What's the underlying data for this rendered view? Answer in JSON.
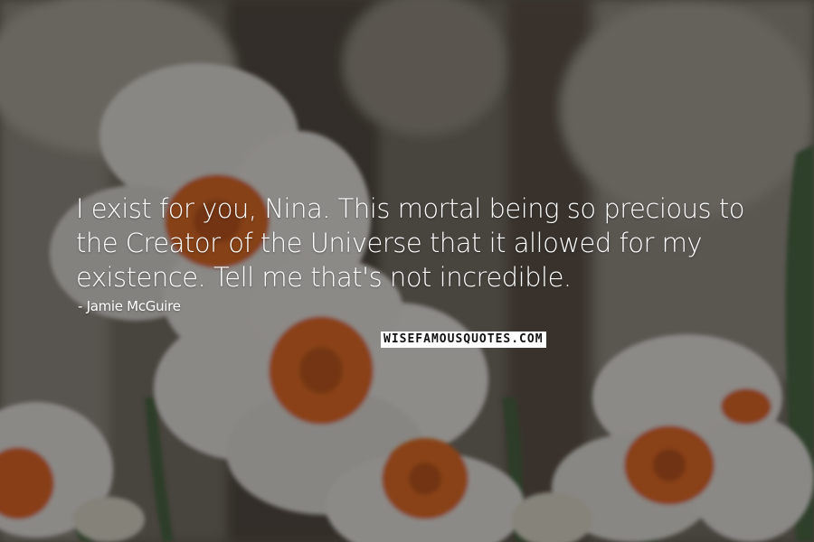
{
  "quote": {
    "text": "I exist for you, Nina. This mortal being so precious to the Creator of the Universe that it allowed for my existence. Tell me that's not incredible.",
    "author": "- Jamie McGuire"
  },
  "watermark": {
    "text": "WISEFAMOUSQUOTES.COM"
  },
  "background": {
    "subject": "white daffodils with orange cups",
    "colors": {
      "petal": "#e8e6e2",
      "cup": "#e0631c",
      "stem": "#3f5a3a",
      "bark": "#4a4038"
    }
  }
}
